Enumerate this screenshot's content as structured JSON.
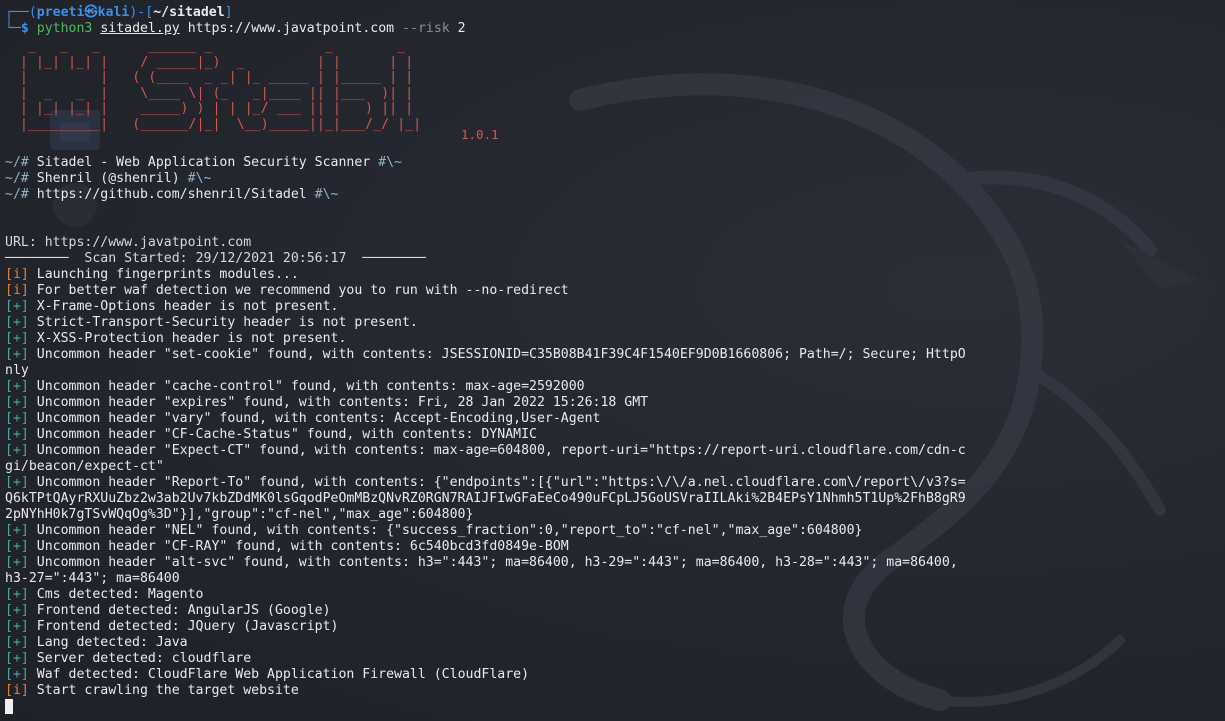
{
  "prompt": {
    "corner_top": "┌──(",
    "user": "preeti",
    "at_symbol": "㉿",
    "host": "kali",
    "sep": ")-[",
    "cwd": "~/sitadel",
    "close": "]",
    "corner_bottom": "└─",
    "dollar": "$",
    "command": "python3",
    "script": "sitadel.py",
    "url_arg": "https://www.javatpoint.com",
    "flag": "--risk",
    "flag_value": "2"
  },
  "banner": {
    "art": [
      " _   _   _      ______ _              _        _ ",
      "| |_| |_| |    / _____|_)  _         | |      | |",
      "|         |   ( (____  _ _| |_ _____ | |_____ | |",
      "|  _   _  |    \\____ \\| (_   _|____ || |___  )| |",
      "| |_| |_| |    _____) ) | | |_/ ___ || |   ) || |",
      "|_________|   (______/|_|  \\__)_____||_|___/_/ |_|"
    ],
    "version": "1.0.1"
  },
  "info_lines": [
    {
      "prefix": "~/# ",
      "text": "Sitadel - Web Application Security Scanner",
      "suffix": " #\\~"
    },
    {
      "prefix": "~/# ",
      "text": "Shenril (@shenril)",
      "suffix": " #\\~"
    },
    {
      "prefix": "~/# ",
      "text": "https://github.com/shenril/Sitadel",
      "suffix": " #\\~"
    }
  ],
  "scan": {
    "url_label": "URL: ",
    "url_value": "https://www.javatpoint.com",
    "divider_left": "────────",
    "scan_started": "  Scan Started: 29/12/2021 20:56:17  ",
    "divider_right": "────────"
  },
  "log_lines": [
    {
      "tag": "[i]",
      "tag_color": "orange",
      "text": " Launching fingerprints modules..."
    },
    {
      "tag": "[i]",
      "tag_color": "orange",
      "text": " For better waf detection we recommend you to run with --no-redirect"
    },
    {
      "tag": "[+]",
      "tag_color": "teal",
      "text": " X-Frame-Options header is not present."
    },
    {
      "tag": "[+]",
      "tag_color": "teal",
      "text": " Strict-Transport-Security header is not present."
    },
    {
      "tag": "[+]",
      "tag_color": "teal",
      "text": " X-XSS-Protection header is not present."
    },
    {
      "tag": "[+]",
      "tag_color": "teal",
      "text": " Uncommon header \"set-cookie\" found, with contents: JSESSIONID=C35B08B41F39C4F1540EF9D0B1660806; Path=/; Secure; HttpO"
    },
    {
      "tag": "",
      "tag_color": "teal",
      "text": "nly"
    },
    {
      "tag": "[+]",
      "tag_color": "teal",
      "text": " Uncommon header \"cache-control\" found, with contents: max-age=2592000"
    },
    {
      "tag": "[+]",
      "tag_color": "teal",
      "text": " Uncommon header \"expires\" found, with contents: Fri, 28 Jan 2022 15:26:18 GMT"
    },
    {
      "tag": "[+]",
      "tag_color": "teal",
      "text": " Uncommon header \"vary\" found, with contents: Accept-Encoding,User-Agent"
    },
    {
      "tag": "[+]",
      "tag_color": "teal",
      "text": " Uncommon header \"CF-Cache-Status\" found, with contents: DYNAMIC"
    },
    {
      "tag": "[+]",
      "tag_color": "teal",
      "text": " Uncommon header \"Expect-CT\" found, with contents: max-age=604800, report-uri=\"https://report-uri.cloudflare.com/cdn-c"
    },
    {
      "tag": "",
      "tag_color": "teal",
      "text": "gi/beacon/expect-ct\""
    },
    {
      "tag": "[+]",
      "tag_color": "teal",
      "text": " Uncommon header \"Report-To\" found, with contents: {\"endpoints\":[{\"url\":\"https:\\/\\/a.nel.cloudflare.com\\/report\\/v3?s="
    },
    {
      "tag": "",
      "tag_color": "teal",
      "text": "Q6kTPtQAyrRXUuZbz2w3ab2Uv7kbZDdMK0lsGqodPeOmMBzQNvRZ0RGN7RAIJFIwGFaEeCo490uFCpLJ5GoUSVraIILAki%2B4EPsY1Nhmh5T1Up%2FhB8gR9"
    },
    {
      "tag": "",
      "tag_color": "teal",
      "text": "2pNYhH0k7gTSvWQqOg%3D\"}],\"group\":\"cf-nel\",\"max_age\":604800}"
    },
    {
      "tag": "[+]",
      "tag_color": "teal",
      "text": " Uncommon header \"NEL\" found, with contents: {\"success_fraction\":0,\"report_to\":\"cf-nel\",\"max_age\":604800}"
    },
    {
      "tag": "[+]",
      "tag_color": "teal",
      "text": " Uncommon header \"CF-RAY\" found, with contents: 6c540bcd3fd0849e-BOM"
    },
    {
      "tag": "[+]",
      "tag_color": "teal",
      "text": " Uncommon header \"alt-svc\" found, with contents: h3=\":443\"; ma=86400, h3-29=\":443\"; ma=86400, h3-28=\":443\"; ma=86400,"
    },
    {
      "tag": "",
      "tag_color": "teal",
      "text": "h3-27=\":443\"; ma=86400"
    },
    {
      "tag": "[+]",
      "tag_color": "teal",
      "text": " Cms detected: Magento"
    },
    {
      "tag": "[+]",
      "tag_color": "teal",
      "text": " Frontend detected: AngularJS (Google)"
    },
    {
      "tag": "[+]",
      "tag_color": "teal",
      "text": " Frontend detected: JQuery (Javascript)"
    },
    {
      "tag": "[+]",
      "tag_color": "teal",
      "text": " Lang detected: Java"
    },
    {
      "tag": "[+]",
      "tag_color": "teal",
      "text": " Server detected: cloudflare"
    },
    {
      "tag": "[+]",
      "tag_color": "teal",
      "text": " Waf detected: CloudFlare Web Application Firewall (CloudFlare)"
    },
    {
      "tag": "[i]",
      "tag_color": "orange",
      "text": " Start crawling the target website"
    }
  ],
  "colors": {
    "background": "#23262e",
    "prompt_blue": "#3f8fe8",
    "tag_teal": "#4ea3a3",
    "tag_orange": "#e0823a",
    "banner_red": "#d8574a"
  },
  "desktop_ghost": {
    "label": "Home"
  }
}
